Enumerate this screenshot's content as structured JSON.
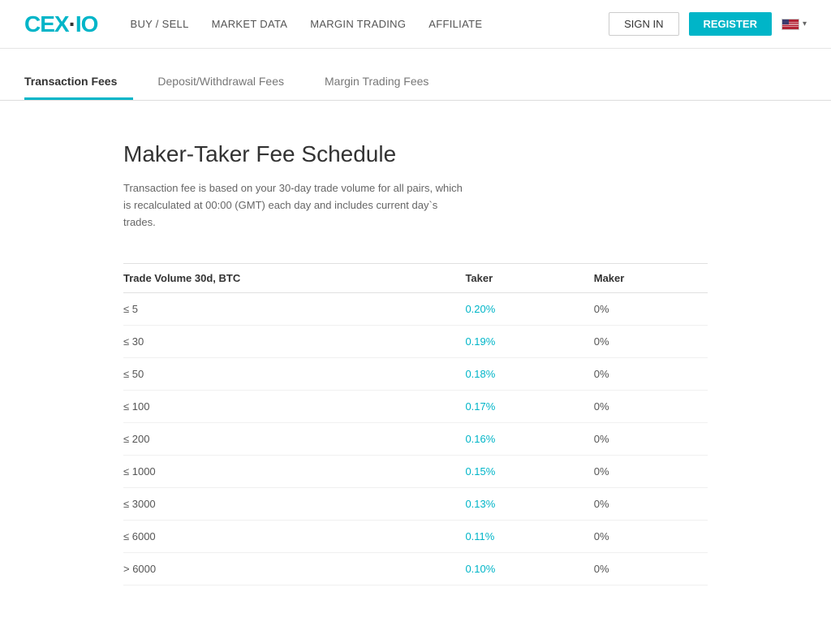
{
  "header": {
    "logo": "CEX·IO",
    "nav": [
      {
        "label": "BUY / SELL",
        "id": "buy-sell"
      },
      {
        "label": "MARKET DATA",
        "id": "market-data"
      },
      {
        "label": "MARGIN TRADING",
        "id": "margin-trading"
      },
      {
        "label": "AFFILIATE",
        "id": "affiliate"
      }
    ],
    "signin_label": "SIGN IN",
    "register_label": "REGISTER"
  },
  "tabs": [
    {
      "label": "Transaction Fees",
      "id": "transaction-fees",
      "active": true
    },
    {
      "label": "Deposit/Withdrawal Fees",
      "id": "deposit-withdrawal-fees",
      "active": false
    },
    {
      "label": "Margin Trading Fees",
      "id": "margin-trading-fees",
      "active": false
    }
  ],
  "content": {
    "title": "Maker-Taker Fee Schedule",
    "description": "Transaction fee is based on your 30-day trade volume for all pairs, which is recalculated at 00:00 (GMT) each day and includes current day`s trades.",
    "table": {
      "columns": [
        {
          "label": "Trade Volume 30d, BTC",
          "id": "volume"
        },
        {
          "label": "Taker",
          "id": "taker"
        },
        {
          "label": "Maker",
          "id": "maker"
        }
      ],
      "rows": [
        {
          "volume": "≤ 5",
          "taker": "0.20%",
          "maker": "0%"
        },
        {
          "volume": "≤ 30",
          "taker": "0.19%",
          "maker": "0%"
        },
        {
          "volume": "≤ 50",
          "taker": "0.18%",
          "maker": "0%"
        },
        {
          "volume": "≤ 100",
          "taker": "0.17%",
          "maker": "0%"
        },
        {
          "volume": "≤ 200",
          "taker": "0.16%",
          "maker": "0%"
        },
        {
          "volume": "≤ 1000",
          "taker": "0.15%",
          "maker": "0%"
        },
        {
          "volume": "≤ 3000",
          "taker": "0.13%",
          "maker": "0%"
        },
        {
          "volume": "≤ 6000",
          "taker": "0.11%",
          "maker": "0%"
        },
        {
          "> 6000": "> 6000",
          "volume": "> 6000",
          "taker": "0.10%",
          "maker": "0%"
        }
      ]
    }
  }
}
